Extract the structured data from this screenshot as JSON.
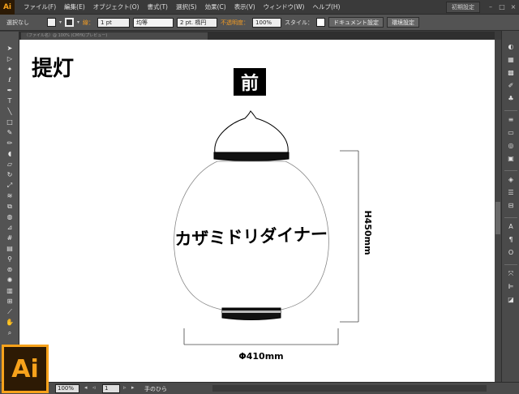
{
  "app": {
    "logo": "Ai",
    "menus": [
      "ファイル(F)",
      "編集(E)",
      "オブジェクト(O)",
      "書式(T)",
      "選択(S)",
      "効果(C)",
      "表示(V)",
      "ウィンドウ(W)",
      "ヘルプ(H)"
    ],
    "workspace": "初期設定",
    "window_buttons": [
      "–",
      "□",
      "×"
    ]
  },
  "control_bar": {
    "selection": "選択なし",
    "stroke_label": "線：",
    "stroke_weight": "1 pt",
    "profile": "均等",
    "brush": "2 pt. 楕円",
    "opacity_label": "不透明度：",
    "opacity_value": "100%",
    "style_label": "スタイル：",
    "doc_settings": "ドキュメント設定",
    "prefs": "環境設定"
  },
  "document_tab": "（ファイル名）@ 100% (CMYK/プレビュー)",
  "artboard": {
    "title": "提灯",
    "view_label": "前",
    "lantern_text": "カザミドリダイナー",
    "height_dim": "H450mm",
    "width_dim": "Φ410mm"
  },
  "status": {
    "zoom": "100%",
    "page": "1",
    "tool": "手のひら"
  },
  "icons": {
    "toolbox": [
      "selection-icon",
      "direct-selection-icon",
      "magic-wand-icon",
      "lasso-icon",
      "pen-icon",
      "type-icon",
      "line-icon",
      "rectangle-icon",
      "paintbrush-icon",
      "pencil-icon",
      "blob-brush-icon",
      "eraser-icon",
      "rotate-icon",
      "scale-icon",
      "warp-icon",
      "free-transform-icon",
      "shape-builder-icon",
      "perspective-icon",
      "mesh-icon",
      "gradient-icon",
      "eyedropper-icon",
      "blend-icon",
      "symbol-sprayer-icon",
      "graph-icon",
      "artboard-icon",
      "slice-icon",
      "hand-icon",
      "zoom-icon"
    ],
    "panel": [
      "color-icon",
      "color-guide-icon",
      "swatches-icon",
      "brushes-icon",
      "symbols-icon",
      "stroke-icon",
      "gradient-panel-icon",
      "transparency-icon",
      "appearance-icon",
      "graphic-styles-icon",
      "layers-icon",
      "artboards-icon",
      "character-icon",
      "paragraph-icon",
      "opentype-icon",
      "transform-icon",
      "align-icon",
      "pathfinder-icon"
    ]
  },
  "colors": {
    "accent": "#f7a21b",
    "chrome": "#535353",
    "canvas": "#ffffff"
  }
}
